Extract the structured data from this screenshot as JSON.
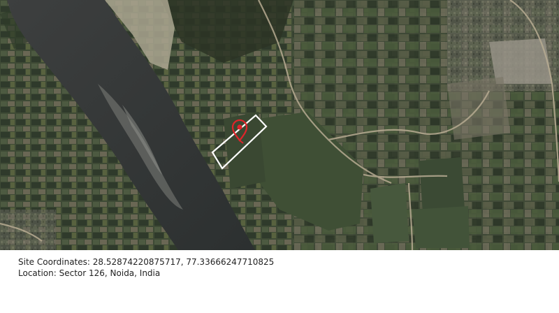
{
  "map": {
    "type": "satellite",
    "marker_icon": "location-pin-icon",
    "marker_color": "#e0242a",
    "boundary_color": "#ffffff"
  },
  "caption": {
    "coordinates_text": "Site Coordinates: 28.52874220875717, 77.33666247710825",
    "location_text": "Location: Sector 126, Noida, India"
  }
}
